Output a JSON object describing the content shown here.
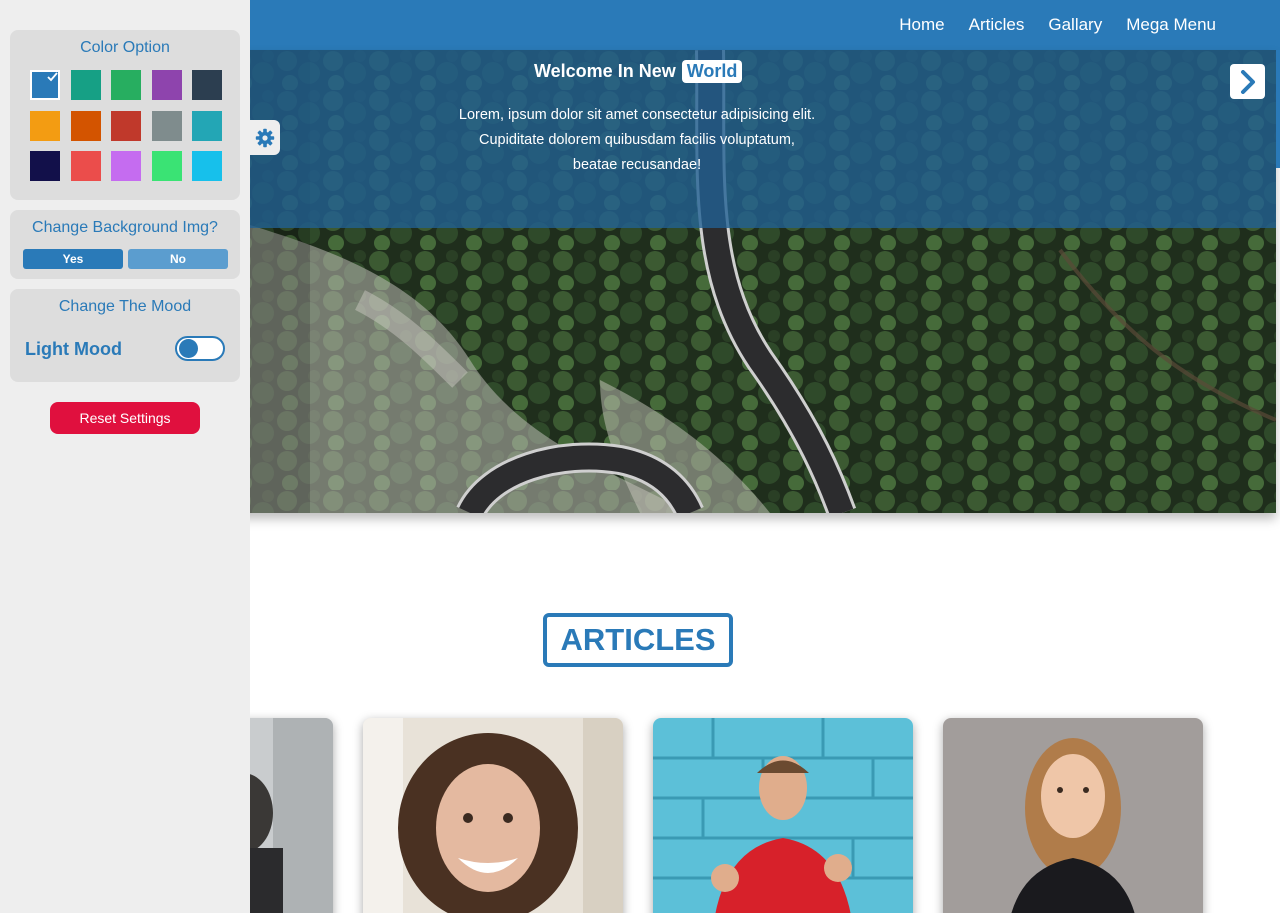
{
  "nav": {
    "links": [
      "Home",
      "Articles",
      "Gallary",
      "Mega Menu"
    ]
  },
  "hero": {
    "title_prefix": "Welcome In New",
    "title_highlight": "World",
    "lines": [
      "Lorem, ipsum dolor sit amet consectetur adipisicing elit.",
      "Cupiditate dolorem quibusdam facilis voluptatum,",
      "beatae recusandae!"
    ],
    "next_icon": "chevron-right-icon"
  },
  "articles": {
    "heading": "ARTICLES",
    "cards": [
      {
        "name": "article-card-1",
        "photo": "man-portrait-grey"
      },
      {
        "name": "article-card-2",
        "photo": "woman-smiling-curly-hair"
      },
      {
        "name": "article-card-3",
        "photo": "man-cheering-blue-wall"
      },
      {
        "name": "article-card-4",
        "photo": "woman-blonde-portrait"
      }
    ]
  },
  "settings": {
    "gear_icon": "gear-icon",
    "color_option": {
      "title": "Color Option",
      "colors": [
        "#2a7ab8",
        "#16a085",
        "#27ae60",
        "#8e44ad",
        "#2c3e50",
        "#f39c12",
        "#d35400",
        "#c0392b",
        "#7f8c8d",
        "#23a6b5",
        "#12104a",
        "#eb4d4b",
        "#c56cf0",
        "#3ae374",
        "#17c0eb"
      ],
      "selected_index": 0
    },
    "background": {
      "title": "Change Background Img?",
      "yes_label": "Yes",
      "no_label": "No",
      "selected": "Yes"
    },
    "mood": {
      "title": "Change The Mood",
      "label": "Light Mood",
      "toggle_on": false
    },
    "reset_label": "Reset Settings"
  },
  "theme": {
    "accent": "#2a7ab8",
    "reset": "#e0103e",
    "panel_bg": "#eeeeee",
    "box_bg": "#dddddd"
  }
}
